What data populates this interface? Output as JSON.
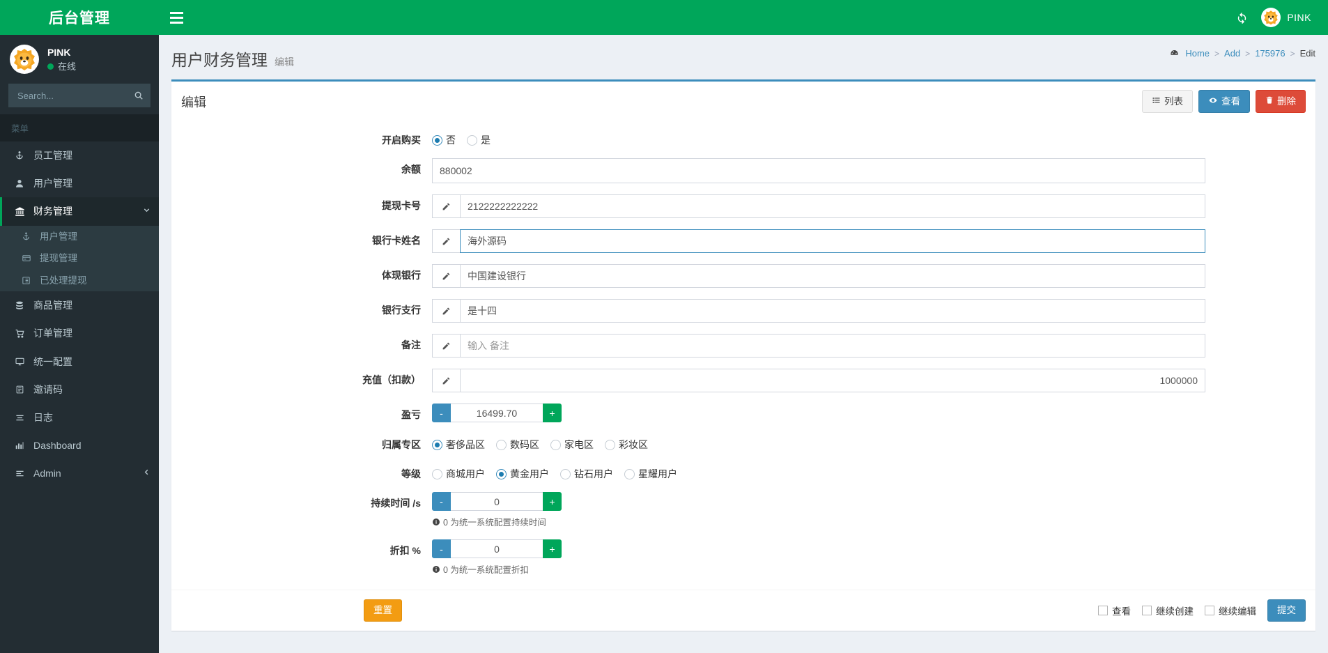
{
  "app": {
    "logo_title": "后台管理",
    "accent_green": "#00a65a",
    "accent_blue": "#3c8dbc",
    "danger_red": "#dd4b39",
    "warning_orange": "#f39c12",
    "sidebar_bg": "#232d33"
  },
  "navbar": {
    "menu_toggle_icon": "hamburger-icon",
    "refresh_icon": "refresh-icon",
    "user_name": "PINK",
    "avatar_icon": "lion-avatar-icon"
  },
  "sidebar": {
    "user": {
      "name": "PINK",
      "status": "在线"
    },
    "search": {
      "value": "",
      "placeholder": "Search...",
      "icon": "search-icon"
    },
    "menu_header": "菜单",
    "items": [
      {
        "label": "员工管理",
        "icon": "anchor-user-icon",
        "active": false
      },
      {
        "label": "用户管理",
        "icon": "user-icon",
        "active": false
      },
      {
        "label": "财务管理",
        "icon": "bank-icon",
        "active": true,
        "caret": "chevron-down-icon",
        "children": [
          {
            "label": "用户管理",
            "icon": "anchor-icon"
          },
          {
            "label": "提现管理",
            "icon": "card-icon"
          },
          {
            "label": "已处理提现",
            "icon": "list-alt-icon"
          }
        ]
      },
      {
        "label": "商品管理",
        "icon": "database-icon",
        "active": false
      },
      {
        "label": "订单管理",
        "icon": "cart-icon",
        "active": false
      },
      {
        "label": "统一配置",
        "icon": "desktop-icon",
        "active": false
      },
      {
        "label": "邀请码",
        "icon": "list-alt-icon",
        "active": false
      },
      {
        "label": "日志",
        "icon": "align-icon",
        "active": false
      },
      {
        "label": "Dashboard",
        "icon": "bar-chart-icon",
        "active": false
      },
      {
        "label": "Admin",
        "icon": "align-left-icon",
        "active": false,
        "caret": "chevron-left-icon"
      }
    ]
  },
  "page": {
    "title": "用户财务管理",
    "subtitle": "编辑",
    "breadcrumb": [
      {
        "label": "Home",
        "icon": "dashboard-home-icon"
      },
      {
        "label": "Add"
      },
      {
        "label": "175976"
      },
      {
        "label": "Edit"
      }
    ],
    "breadcrumb_separator": ">"
  },
  "card": {
    "title": "编辑",
    "tools": [
      {
        "label": "列表",
        "icon": "list-icon",
        "style": "default"
      },
      {
        "label": "查看",
        "icon": "eye-icon",
        "style": "primary"
      },
      {
        "label": "删除",
        "icon": "trash-icon",
        "style": "danger"
      }
    ]
  },
  "form": {
    "fields": [
      {
        "type": "radio",
        "label": "开启购买",
        "options": [
          {
            "label": "否",
            "checked": true
          },
          {
            "label": "是",
            "checked": false
          }
        ]
      },
      {
        "type": "text",
        "label": "余额",
        "value": "880002",
        "placeholder": "",
        "addon": false,
        "focused": false,
        "tall": true
      },
      {
        "type": "text",
        "label": "提现卡号",
        "value": "2122222222222",
        "placeholder": "",
        "addon": true,
        "addon_icon": "pencil-icon",
        "focused": false
      },
      {
        "type": "text",
        "label": "银行卡姓名",
        "value": "海外源码",
        "placeholder": "",
        "addon": true,
        "addon_icon": "pencil-icon",
        "focused": true
      },
      {
        "type": "text",
        "label": "体现银行",
        "value": "中国建设银行",
        "placeholder": "",
        "addon": true,
        "addon_icon": "pencil-icon",
        "focused": false
      },
      {
        "type": "text",
        "label": "银行支行",
        "value": "是十四",
        "placeholder": "",
        "addon": true,
        "addon_icon": "pencil-icon",
        "focused": false
      },
      {
        "type": "text",
        "label": "备注",
        "value": "",
        "placeholder": "输入 备注",
        "addon": true,
        "addon_icon": "pencil-icon",
        "focused": false
      },
      {
        "type": "text",
        "label": "充值（扣款）",
        "value": "1000000",
        "placeholder": "",
        "addon": true,
        "addon_icon": "pencil-icon",
        "focused": false,
        "align_right": true
      },
      {
        "type": "spinner",
        "label": "盈亏",
        "value": "16499.70",
        "minus": "-",
        "plus": "+",
        "help": ""
      },
      {
        "type": "radio",
        "label": "归属专区",
        "options": [
          {
            "label": "奢侈品区",
            "checked": true
          },
          {
            "label": "数码区",
            "checked": false
          },
          {
            "label": "家电区",
            "checked": false
          },
          {
            "label": "彩妆区",
            "checked": false
          }
        ]
      },
      {
        "type": "radio",
        "label": "等级",
        "options": [
          {
            "label": "商城用户",
            "checked": false
          },
          {
            "label": "黄金用户",
            "checked": true
          },
          {
            "label": "钻石用户",
            "checked": false
          },
          {
            "label": "星耀用户",
            "checked": false
          }
        ]
      },
      {
        "type": "spinner",
        "label": "持续时间 /s",
        "value": "0",
        "minus": "-",
        "plus": "+",
        "help": "0 为统一系统配置持续时间"
      },
      {
        "type": "spinner",
        "label": "折扣 %",
        "value": "0",
        "minus": "-",
        "plus": "+",
        "help": "0 为统一系统配置折扣"
      }
    ]
  },
  "footer": {
    "reset_label": "重置",
    "checkboxes": [
      {
        "label": "查看",
        "checked": false
      },
      {
        "label": "继续创建",
        "checked": false
      },
      {
        "label": "继续编辑",
        "checked": false
      }
    ],
    "submit_label": "提交"
  }
}
